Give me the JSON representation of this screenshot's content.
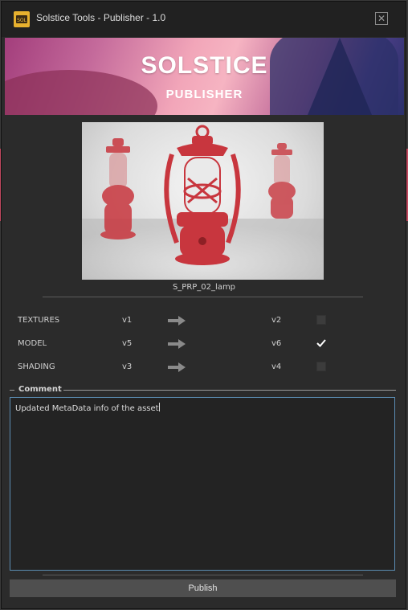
{
  "window": {
    "title": "Solstice Tools - Publisher - 1.0",
    "close_glyph": "✕",
    "app_icon": "solstice-app-icon"
  },
  "banner": {
    "logo_title": "SOLSTICE",
    "logo_subtitle": "PUBLISHER"
  },
  "preview": {
    "asset_name": "S_PRP_02_lamp"
  },
  "components": [
    {
      "name": "TEXTURES",
      "current_version": "v1",
      "new_version": "v2",
      "checked": false
    },
    {
      "name": "MODEL",
      "current_version": "v5",
      "new_version": "v6",
      "checked": true
    },
    {
      "name": "SHADING",
      "current_version": "v3",
      "new_version": "v4",
      "checked": false
    }
  ],
  "comment": {
    "label": "Comment",
    "value": "Updated MetaData info of the asset"
  },
  "publish": {
    "label": "Publish"
  },
  "colors": {
    "window_bg": "#2b2b2b",
    "titlebar_bg": "#212121",
    "accent_border": "#5b8db3",
    "lantern_red": "#c8363e"
  }
}
